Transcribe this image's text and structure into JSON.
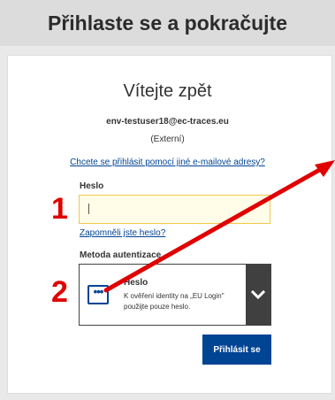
{
  "header": {
    "title": "Přihlaste se a pokračujte"
  },
  "login": {
    "welcome": "Vítejte zpět",
    "email": "env-testuser18@ec-traces.eu",
    "account_type": "(Externí)",
    "alt_email_link": "Chcete se přihlásit pomocí jiné e-mailové adresy?",
    "password_label": "Heslo",
    "password_value": "",
    "forgot_link": "Zapomněli jste heslo?",
    "method_label": "Metoda autentizace",
    "method": {
      "title": "Heslo",
      "description": "K ověření identity na „EU Login\" použijte pouze heslo.",
      "icon": "password-dots-icon"
    },
    "submit_label": "Přihlásit se"
  },
  "annotations": {
    "marker_1": "1",
    "marker_2": "2",
    "color": "#e00000"
  },
  "colors": {
    "accent": "#004494",
    "input_border": "#f2c94c",
    "chevron_bg": "#404040"
  }
}
